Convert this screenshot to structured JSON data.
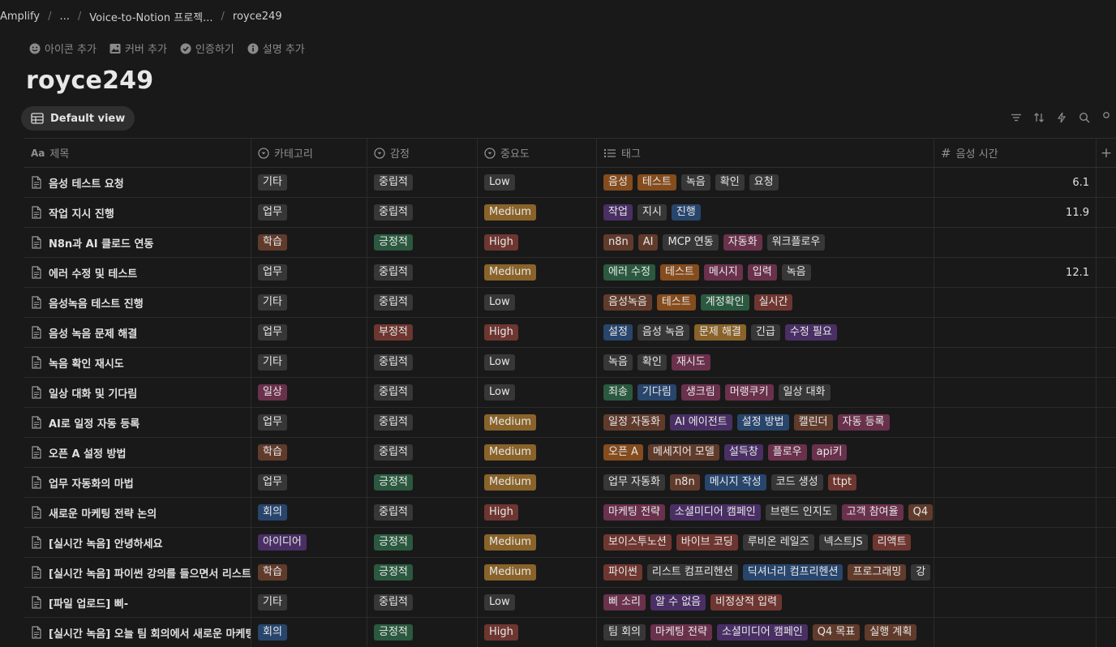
{
  "breadcrumb": [
    "Amplify",
    "...",
    "Voice-to-Notion 프로젝...",
    "royce249"
  ],
  "page_actions": [
    {
      "label": "아이콘 추가",
      "icon": "smiley-icon"
    },
    {
      "label": "커버 추가",
      "icon": "image-icon"
    },
    {
      "label": "인증하기",
      "icon": "verified-icon"
    },
    {
      "label": "설명 추가",
      "icon": "info-icon"
    }
  ],
  "title": "royce249",
  "view": {
    "label": "Default view",
    "icon": "table-icon"
  },
  "toolbar_icons": [
    "filter-icon",
    "sort-icon",
    "automation-icon",
    "search-icon",
    "more-icon"
  ],
  "columns": [
    {
      "key": "title",
      "label": "제목",
      "icon": "text-icon"
    },
    {
      "key": "category",
      "label": "카테고리",
      "icon": "select-icon"
    },
    {
      "key": "emotion",
      "label": "감정",
      "icon": "select-icon"
    },
    {
      "key": "importance",
      "label": "중요도",
      "icon": "select-icon"
    },
    {
      "key": "tags",
      "label": "태그",
      "icon": "multiselect-icon"
    },
    {
      "key": "duration",
      "label": "음성 시간",
      "icon": "number-icon"
    }
  ],
  "add_column_label": "+",
  "colors": {
    "orange": "#854c1d",
    "gray": "#373737",
    "purple": "#492f64",
    "blue": "#28456c",
    "green": "#2b593f",
    "red": "#6e3630",
    "pink": "#69314c",
    "brown": "#603b2c",
    "yellow": "#89632a"
  },
  "rows": [
    {
      "title": "음성 테스트 요청",
      "category": {
        "label": "기타",
        "color": "gray"
      },
      "emotion": {
        "label": "중립적",
        "color": "gray"
      },
      "importance": {
        "label": "Low",
        "color": "gray"
      },
      "tags": [
        {
          "label": "음성",
          "color": "orange"
        },
        {
          "label": "테스트",
          "color": "orange"
        },
        {
          "label": "녹음",
          "color": "gray"
        },
        {
          "label": "확인",
          "color": "gray"
        },
        {
          "label": "요청",
          "color": "gray"
        }
      ],
      "duration": "6.1"
    },
    {
      "title": "작업 지시 진행",
      "category": {
        "label": "업무",
        "color": "gray"
      },
      "emotion": {
        "label": "중립적",
        "color": "gray"
      },
      "importance": {
        "label": "Medium",
        "color": "yellow"
      },
      "tags": [
        {
          "label": "작업",
          "color": "purple"
        },
        {
          "label": "지시",
          "color": "gray"
        },
        {
          "label": "진행",
          "color": "blue"
        }
      ],
      "duration": "11.9"
    },
    {
      "title": "N8n과 AI 클로드 연동",
      "category": {
        "label": "학습",
        "color": "brown"
      },
      "emotion": {
        "label": "긍정적",
        "color": "green"
      },
      "importance": {
        "label": "High",
        "color": "red"
      },
      "tags": [
        {
          "label": "n8n",
          "color": "brown"
        },
        {
          "label": "AI",
          "color": "brown"
        },
        {
          "label": "MCP 연동",
          "color": "gray"
        },
        {
          "label": "자동화",
          "color": "pink"
        },
        {
          "label": "워크플로우",
          "color": "gray"
        }
      ],
      "duration": ""
    },
    {
      "title": "에러 수정 및 테스트",
      "category": {
        "label": "업무",
        "color": "gray"
      },
      "emotion": {
        "label": "중립적",
        "color": "gray"
      },
      "importance": {
        "label": "Medium",
        "color": "yellow"
      },
      "tags": [
        {
          "label": "에러 수정",
          "color": "green"
        },
        {
          "label": "테스트",
          "color": "orange"
        },
        {
          "label": "메시지",
          "color": "pink"
        },
        {
          "label": "입력",
          "color": "pink"
        },
        {
          "label": "녹음",
          "color": "gray"
        }
      ],
      "duration": "12.1"
    },
    {
      "title": "음성녹음 테스트 진행",
      "category": {
        "label": "기타",
        "color": "gray"
      },
      "emotion": {
        "label": "중립적",
        "color": "gray"
      },
      "importance": {
        "label": "Low",
        "color": "gray"
      },
      "tags": [
        {
          "label": "음성녹음",
          "color": "brown"
        },
        {
          "label": "테스트",
          "color": "orange"
        },
        {
          "label": "계정확인",
          "color": "green"
        },
        {
          "label": "실시간",
          "color": "red"
        }
      ],
      "duration": ""
    },
    {
      "title": "음성 녹음 문제 해결",
      "category": {
        "label": "업무",
        "color": "gray"
      },
      "emotion": {
        "label": "부정적",
        "color": "red"
      },
      "importance": {
        "label": "High",
        "color": "red"
      },
      "tags": [
        {
          "label": "설정",
          "color": "blue"
        },
        {
          "label": "음성 녹음",
          "color": "gray"
        },
        {
          "label": "문제 해결",
          "color": "yellow"
        },
        {
          "label": "긴급",
          "color": "gray"
        },
        {
          "label": "수정 필요",
          "color": "purple"
        }
      ],
      "duration": ""
    },
    {
      "title": "녹음 확인 재시도",
      "category": {
        "label": "기타",
        "color": "gray"
      },
      "emotion": {
        "label": "중립적",
        "color": "gray"
      },
      "importance": {
        "label": "Low",
        "color": "gray"
      },
      "tags": [
        {
          "label": "녹음",
          "color": "gray"
        },
        {
          "label": "확인",
          "color": "gray"
        },
        {
          "label": "재시도",
          "color": "pink"
        }
      ],
      "duration": ""
    },
    {
      "title": "일상 대화 및 기다림",
      "category": {
        "label": "일상",
        "color": "pink"
      },
      "emotion": {
        "label": "중립적",
        "color": "gray"
      },
      "importance": {
        "label": "Low",
        "color": "gray"
      },
      "tags": [
        {
          "label": "죄송",
          "color": "green"
        },
        {
          "label": "기다림",
          "color": "blue"
        },
        {
          "label": "생크림",
          "color": "pink"
        },
        {
          "label": "머랭쿠키",
          "color": "pink"
        },
        {
          "label": "일상 대화",
          "color": "gray"
        }
      ],
      "duration": ""
    },
    {
      "title": "AI로 일정 자동 등록",
      "category": {
        "label": "업무",
        "color": "gray"
      },
      "emotion": {
        "label": "중립적",
        "color": "gray"
      },
      "importance": {
        "label": "Medium",
        "color": "yellow"
      },
      "tags": [
        {
          "label": "일정 자동화",
          "color": "brown"
        },
        {
          "label": "AI 에이전트",
          "color": "purple"
        },
        {
          "label": "설정 방법",
          "color": "blue"
        },
        {
          "label": "캘린더",
          "color": "brown"
        },
        {
          "label": "자동 등록",
          "color": "pink"
        }
      ],
      "duration": ""
    },
    {
      "title": "오픈 A 설정 방법",
      "category": {
        "label": "학습",
        "color": "brown"
      },
      "emotion": {
        "label": "중립적",
        "color": "gray"
      },
      "importance": {
        "label": "Medium",
        "color": "yellow"
      },
      "tags": [
        {
          "label": "오픈 A",
          "color": "orange"
        },
        {
          "label": "메세지어 모델",
          "color": "brown"
        },
        {
          "label": "설득창",
          "color": "purple"
        },
        {
          "label": "플로우",
          "color": "pink"
        },
        {
          "label": "api키",
          "color": "pink"
        }
      ],
      "duration": ""
    },
    {
      "title": "업무 자동화의 마법",
      "category": {
        "label": "업무",
        "color": "gray"
      },
      "emotion": {
        "label": "긍정적",
        "color": "green"
      },
      "importance": {
        "label": "Medium",
        "color": "yellow"
      },
      "tags": [
        {
          "label": "업무 자동화",
          "color": "gray"
        },
        {
          "label": "n8n",
          "color": "brown"
        },
        {
          "label": "메시지 작성",
          "color": "blue"
        },
        {
          "label": "코드 생성",
          "color": "gray"
        },
        {
          "label": "ttpt",
          "color": "red"
        }
      ],
      "duration": ""
    },
    {
      "title": "새로운 마케팅 전략 논의",
      "category": {
        "label": "회의",
        "color": "blue"
      },
      "emotion": {
        "label": "중립적",
        "color": "gray"
      },
      "importance": {
        "label": "High",
        "color": "red"
      },
      "tags": [
        {
          "label": "마케팅 전략",
          "color": "pink"
        },
        {
          "label": "소셜미디어 캠페인",
          "color": "purple"
        },
        {
          "label": "브랜드 인지도",
          "color": "gray"
        },
        {
          "label": "고객 참여율",
          "color": "pink"
        },
        {
          "label": "Q4",
          "color": "brown"
        }
      ],
      "duration": ""
    },
    {
      "title": "[실시간 녹음] 안녕하세요",
      "category": {
        "label": "아이디어",
        "color": "purple"
      },
      "emotion": {
        "label": "긍정적",
        "color": "green"
      },
      "importance": {
        "label": "Medium",
        "color": "yellow"
      },
      "tags": [
        {
          "label": "보이스투노션",
          "color": "red"
        },
        {
          "label": "바이브 코딩",
          "color": "red"
        },
        {
          "label": "루비온 레일즈",
          "color": "gray"
        },
        {
          "label": "넥스트JS",
          "color": "gray"
        },
        {
          "label": "리액트",
          "color": "red"
        }
      ],
      "duration": ""
    },
    {
      "title": "[실시간 녹음] 파이썬 강의를 들으면서 리스트",
      "category": {
        "label": "학습",
        "color": "brown"
      },
      "emotion": {
        "label": "긍정적",
        "color": "green"
      },
      "importance": {
        "label": "Medium",
        "color": "yellow"
      },
      "tags": [
        {
          "label": "파이썬",
          "color": "red"
        },
        {
          "label": "리스트 컴프리헨션",
          "color": "gray"
        },
        {
          "label": "딕셔너리 컴프리헨션",
          "color": "blue"
        },
        {
          "label": "프로그래밍",
          "color": "brown"
        },
        {
          "label": "강",
          "color": "gray"
        }
      ],
      "duration": ""
    },
    {
      "title": "[파일 업로드] 삐-",
      "category": {
        "label": "기타",
        "color": "gray"
      },
      "emotion": {
        "label": "중립적",
        "color": "gray"
      },
      "importance": {
        "label": "Low",
        "color": "gray"
      },
      "tags": [
        {
          "label": "삐 소리",
          "color": "pink"
        },
        {
          "label": "알 수 없음",
          "color": "purple"
        },
        {
          "label": "비정상적 입력",
          "color": "red"
        }
      ],
      "duration": ""
    },
    {
      "title": "[실시간 녹음] 오늘 팀 회의에서 새로운 마케팅",
      "category": {
        "label": "회의",
        "color": "blue"
      },
      "emotion": {
        "label": "긍정적",
        "color": "green"
      },
      "importance": {
        "label": "High",
        "color": "red"
      },
      "tags": [
        {
          "label": "팀 회의",
          "color": "gray"
        },
        {
          "label": "마케팅 전략",
          "color": "pink"
        },
        {
          "label": "소셜미디어 캠페인",
          "color": "purple"
        },
        {
          "label": "Q4 목표",
          "color": "brown"
        },
        {
          "label": "실행 계획",
          "color": "brown"
        }
      ],
      "duration": ""
    }
  ]
}
